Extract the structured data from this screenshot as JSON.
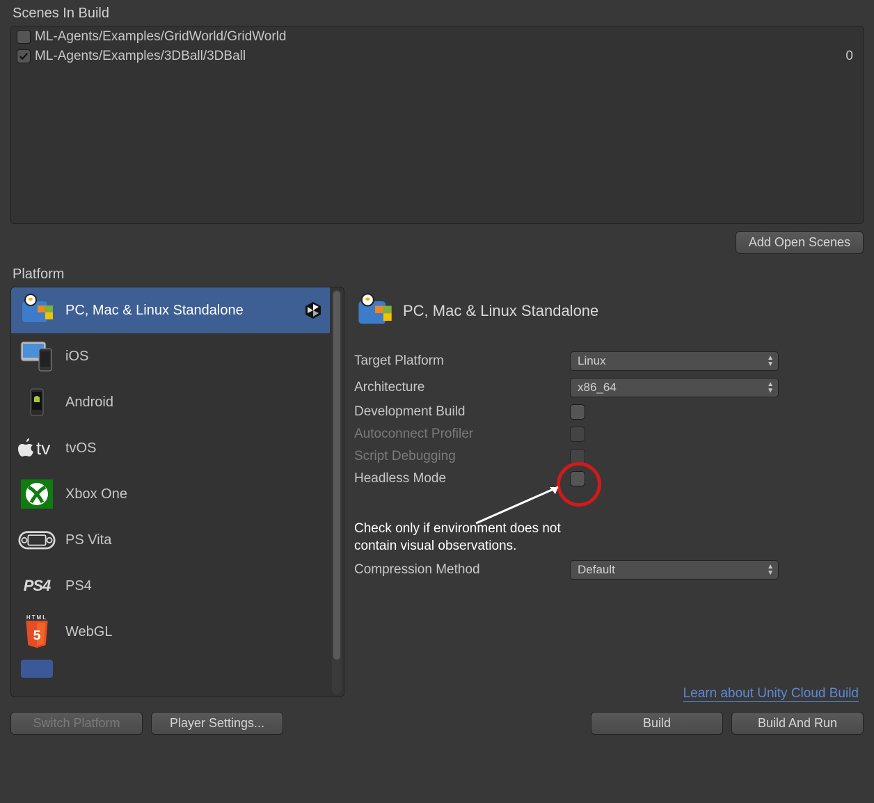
{
  "scenesHeader": "Scenes In Build",
  "scenes": [
    {
      "path": "ML-Agents/Examples/GridWorld/GridWorld",
      "enabled": false,
      "index": ""
    },
    {
      "path": "ML-Agents/Examples/3DBall/3DBall",
      "enabled": true,
      "index": "0"
    }
  ],
  "addOpenScenes": "Add Open Scenes",
  "platformHeader": "Platform",
  "platforms": [
    {
      "label": "PC, Mac & Linux Standalone",
      "icon": "pc-mac-linux-icon",
      "selected": true,
      "current": true
    },
    {
      "label": "iOS",
      "icon": "ios-icon",
      "selected": false,
      "current": false
    },
    {
      "label": "Android",
      "icon": "android-icon",
      "selected": false,
      "current": false
    },
    {
      "label": "tvOS",
      "icon": "appletv-icon",
      "selected": false,
      "current": false
    },
    {
      "label": "Xbox One",
      "icon": "xbox-icon",
      "selected": false,
      "current": false
    },
    {
      "label": "PS Vita",
      "icon": "psvita-icon",
      "selected": false,
      "current": false
    },
    {
      "label": "PS4",
      "icon": "ps4-icon",
      "selected": false,
      "current": false
    },
    {
      "label": "WebGL",
      "icon": "html5-icon",
      "selected": false,
      "current": false
    }
  ],
  "details": {
    "title": "PC, Mac & Linux Standalone",
    "fields": {
      "targetPlatformLabel": "Target Platform",
      "targetPlatformValue": "Linux",
      "architectureLabel": "Architecture",
      "architectureValue": "x86_64",
      "devBuildLabel": "Development Build",
      "autoProfilerLabel": "Autoconnect Profiler",
      "scriptDebugLabel": "Script Debugging",
      "headlessLabel": "Headless Mode",
      "compressionLabel": "Compression Method",
      "compressionValue": "Default"
    }
  },
  "annotation": "Check only if environment does not\ncontain visual observations.",
  "cloudBuildLink": "Learn about Unity Cloud Build",
  "buttons": {
    "switchPlatform": "Switch Platform",
    "playerSettings": "Player Settings...",
    "build": "Build",
    "buildAndRun": "Build And Run"
  }
}
